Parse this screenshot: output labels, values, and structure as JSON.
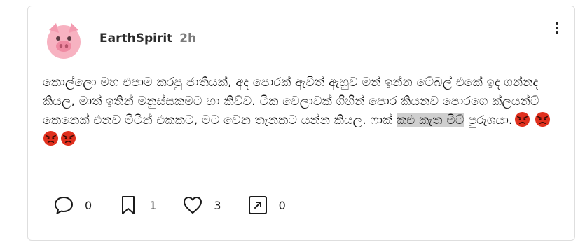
{
  "post": {
    "author": "EarthSpirit",
    "time": "2h",
    "text_before": "කොල්ලො මහ එපාම කරපු ජාතියක්, අද පොරක් ඇවිත් ඇහුව මන් ඉන්න ටේබල් එකේ ඉද ගන්නද කියල, මාත් ඉතින් මනුස්සකමට හා කිව්ව. ටික වෙලාවක් ගිහින් පොර කියනව පොරගෙ ක්ලයන්ට් කෙනෙක් එනව මීටින් එකකට, මට වෙන තැනකට යන්න කියල. ෆාක් ",
    "text_highlight": "කළු කැත මිට්",
    "text_after": " පුරුශයා.",
    "emoji_name": "angry-face-emoji"
  },
  "actions": {
    "comments": {
      "icon": "comment-icon",
      "count": "0"
    },
    "bookmarks": {
      "icon": "bookmark-icon",
      "count": "1"
    },
    "likes": {
      "icon": "heart-icon",
      "count": "3"
    },
    "shares": {
      "icon": "share-icon",
      "count": "0"
    }
  },
  "colors": {
    "highlight": "#cfcfcf",
    "emoji_red": "#e0301e",
    "pig_pink": "#f7a8b8"
  }
}
